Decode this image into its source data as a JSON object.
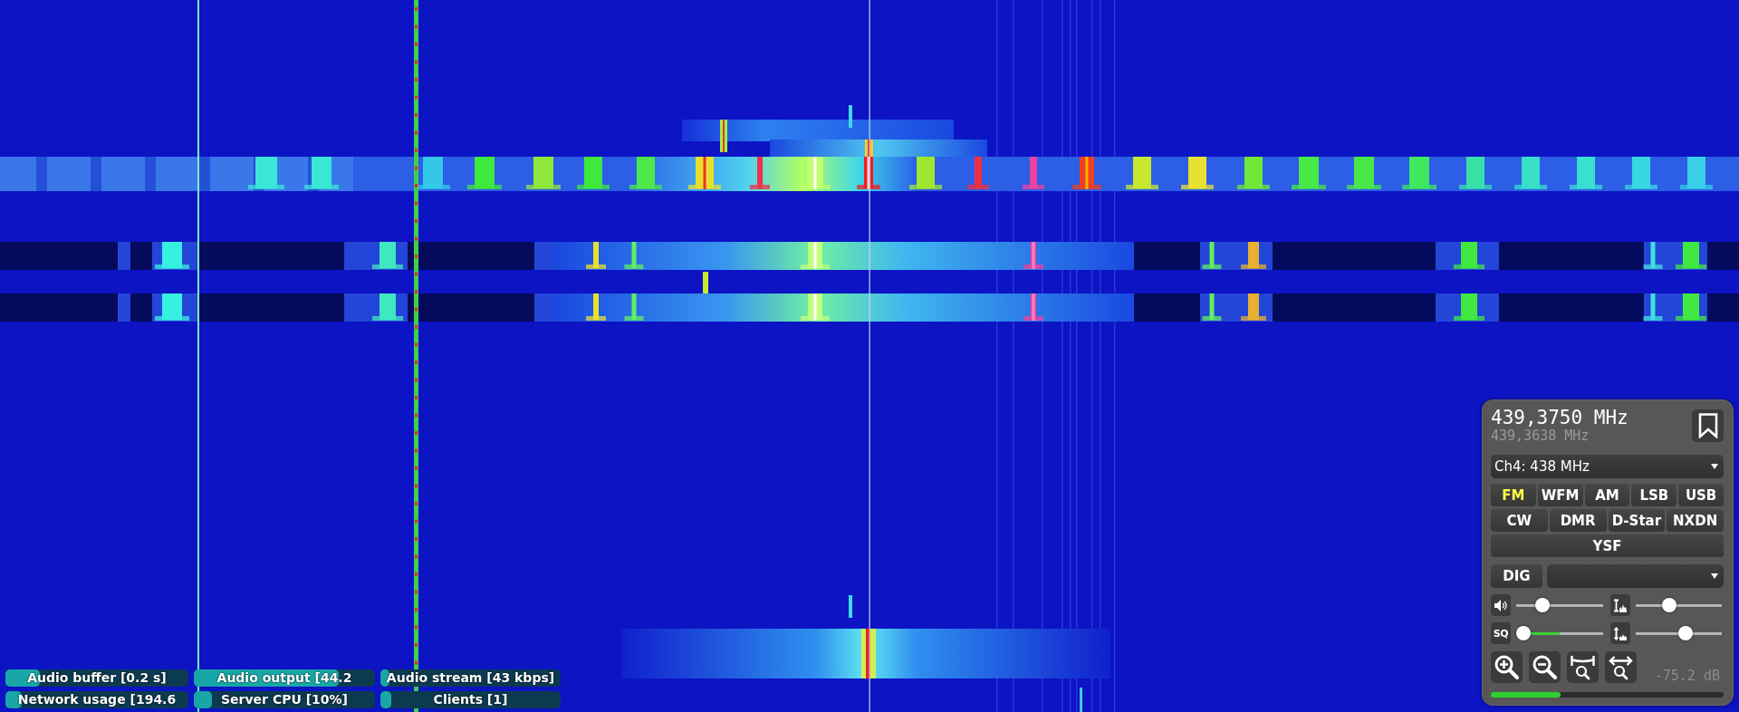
{
  "receiver_panel": {
    "frequency": "439,3750 MHz",
    "offset_frequency": "439,3638 MHz",
    "channel_select": {
      "value": "Ch4: 438 MHz"
    },
    "mode_rows": [
      {
        "buttons": [
          {
            "label": "FM",
            "selected": true
          },
          {
            "label": "WFM",
            "selected": false
          },
          {
            "label": "AM",
            "selected": false
          },
          {
            "label": "LSB",
            "selected": false
          },
          {
            "label": "USB",
            "selected": false
          }
        ]
      },
      {
        "buttons": [
          {
            "label": "CW",
            "selected": false
          },
          {
            "label": "DMR",
            "selected": false
          },
          {
            "label": "D-Star",
            "selected": false
          },
          {
            "label": "NXDN",
            "selected": false
          }
        ]
      },
      {
        "buttons": [
          {
            "label": "YSF",
            "selected": false
          }
        ]
      }
    ],
    "digital_button": {
      "label": "DIG"
    },
    "sliders": [
      {
        "kind": "volume",
        "level": 0.27
      },
      {
        "kind": "spectrum_range",
        "level": 0.37
      },
      {
        "kind": "squelch",
        "label": "SQ",
        "level": 0,
        "signal": {
          "level": 0.5
        }
      },
      {
        "kind": "auto_adjust",
        "level": 0.6
      }
    ],
    "signal_meter": {
      "reading": "-75.2 dB",
      "level": 0.3
    }
  },
  "status_bars": [
    {
      "label": "Audio buffer [0.2 s]",
      "level": 0.19
    },
    {
      "label": "Audio output [44.2",
      "level": 0.8
    },
    {
      "label": "Audio stream [43 kbps]",
      "level": 0.05
    },
    {
      "label": "Network usage [194.6",
      "level": 0.09
    },
    {
      "label": "Server CPU [10%]",
      "level": 0.1
    },
    {
      "label": "Clients [1]",
      "level": 0.06
    }
  ]
}
